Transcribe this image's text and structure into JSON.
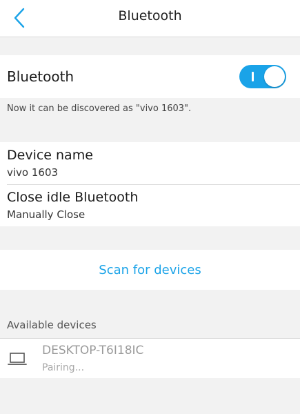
{
  "header": {
    "title": "Bluetooth",
    "back_icon": "chevron-left-icon"
  },
  "bluetooth": {
    "label": "Bluetooth",
    "enabled": true,
    "discover_note": "Now it can be discovered as \"vivo 1603\"."
  },
  "device_info": {
    "name_title": "Device name",
    "name_value": "vivo 1603",
    "idle_title": "Close idle Bluetooth",
    "idle_value": "Manually Close"
  },
  "scan": {
    "label": "Scan for devices"
  },
  "available": {
    "header": "Available devices",
    "devices": [
      {
        "name": "DESKTOP-T6I18IC",
        "status": "Pairing...",
        "icon": "laptop-icon"
      }
    ]
  },
  "colors": {
    "accent": "#1aa3e8",
    "background": "#f2f2f2",
    "surface": "#ffffff"
  }
}
